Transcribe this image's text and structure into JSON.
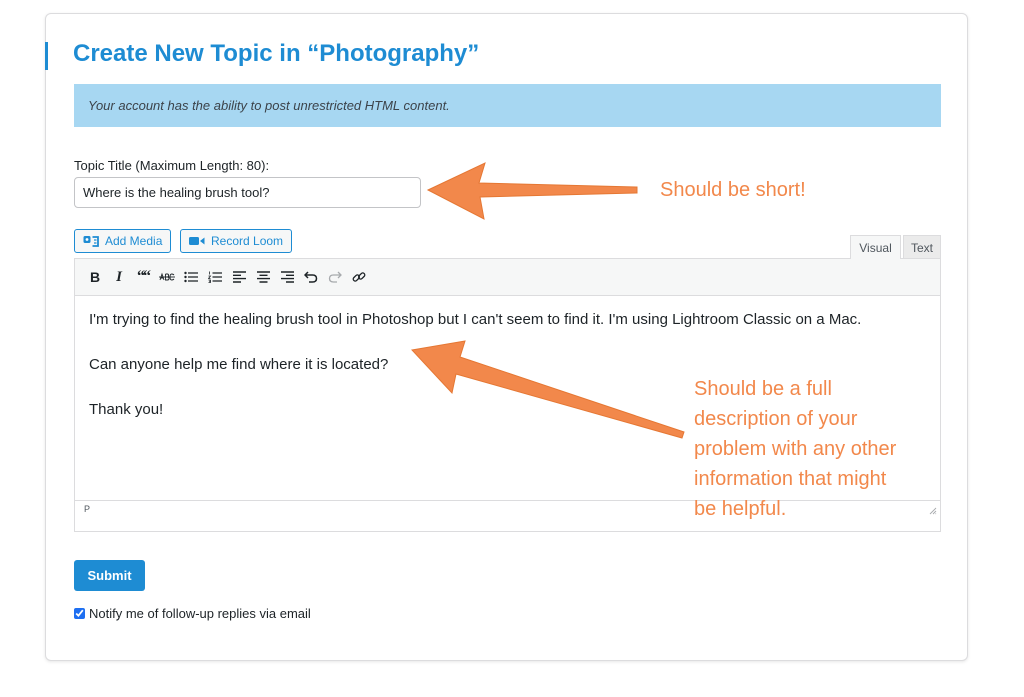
{
  "page": {
    "title": "Create New Topic in “Photography”",
    "notice": "Your account has the ability to post unrestricted HTML content."
  },
  "form": {
    "title_label": "Topic Title (Maximum Length: 80):",
    "title_value": "Where is the healing brush tool?",
    "submit_label": "Submit",
    "notify_label": "Notify me of follow-up replies via email",
    "notify_checked": true
  },
  "editor": {
    "add_media_label": "Add Media",
    "record_loom_label": "Record Loom",
    "tabs": [
      {
        "label": "Visual",
        "active": true
      },
      {
        "label": "Text",
        "active": false
      }
    ],
    "toolbar": {
      "bold": "B",
      "italic": "I",
      "blockquote": "““"
    },
    "paragraphs": [
      "I'm trying to find the healing brush tool in Photoshop but I can't seem to find it. I'm using Lightroom Classic on a Mac.",
      "Can anyone help me find where it is located?",
      "Thank you!"
    ],
    "status_path": "P"
  },
  "annotations": {
    "title_note": "Should be short!",
    "body_note_lines": [
      "Should be a full",
      "description of your",
      "problem with any other",
      "information that might",
      "be helpful."
    ]
  },
  "colors": {
    "accent": "#1e8cd3",
    "notice_bg": "#a7d7f2",
    "annotation": "#f2884b"
  }
}
